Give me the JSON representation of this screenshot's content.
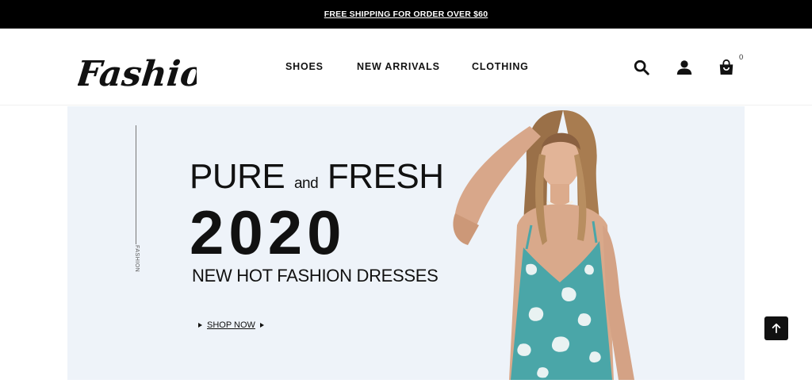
{
  "announcement": {
    "text": "FREE SHIPPING FOR ORDER OVER $60"
  },
  "header": {
    "logo_text": "Fashion",
    "nav": [
      {
        "label": "SHOES"
      },
      {
        "label": "NEW ARRIVALS"
      },
      {
        "label": "CLOTHING"
      }
    ],
    "icons": {
      "search": "search-icon",
      "account": "user-icon",
      "cart": "shopping-bag-icon"
    },
    "cart_count": "0"
  },
  "hero": {
    "side_label": "FASHION",
    "headline_word1": "PURE",
    "headline_and": "and",
    "headline_word2": "FRESH",
    "year": "2020",
    "subtitle": "NEW HOT FASHION DRESSES",
    "cta": "SHOP NOW",
    "background_color": "#eef3f9"
  },
  "scroll_top": {
    "icon": "arrow-up-icon"
  }
}
